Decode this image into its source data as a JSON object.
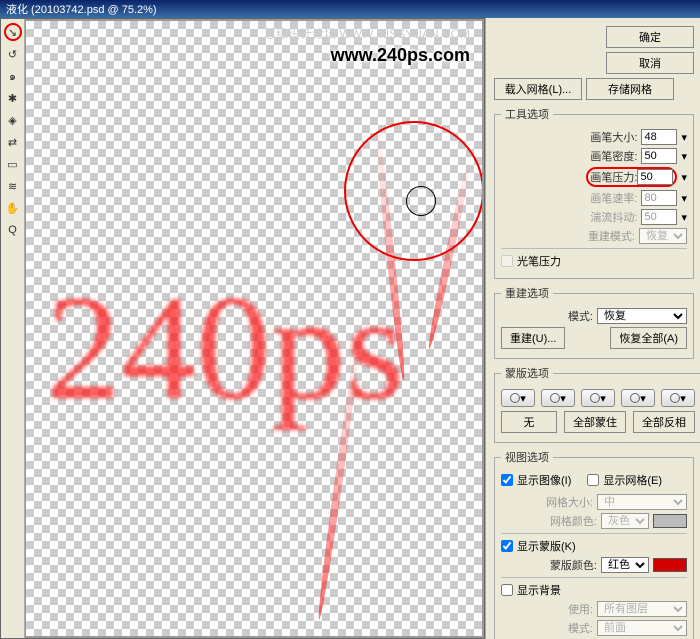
{
  "title": "液化 (20103742.psd @ 75.2%)",
  "watermark": {
    "site": "思缘设计论坛 WWW.MISSYUAN.COM",
    "logo": "www.240ps.com"
  },
  "canvasText": "240ps",
  "buttons": {
    "ok": "确定",
    "cancel": "取消",
    "loadMesh": "载入网格(L)...",
    "saveMesh": "存储网格"
  },
  "toolOptions": {
    "legend": "工具选项",
    "brushSizeLabel": "画笔大小:",
    "brushSize": "48",
    "brushDensityLabel": "画笔密度:",
    "brushDensity": "50",
    "brushPressureLabel": "画笔压力:",
    "brushPressure": "50",
    "brushRateLabel": "画笔速率:",
    "brushRate": "80",
    "turbJitterLabel": "湍流抖动:",
    "turbJitter": "50",
    "reconstructModeLabel": "重建模式:",
    "reconstructMode": "恢复",
    "stylusLabel": "光笔压力"
  },
  "reconstruct": {
    "legend": "重建选项",
    "modeLabel": "模式:",
    "mode": "恢复",
    "reconstructBtn": "重建(U)...",
    "restoreAllBtn": "恢复全部(A)"
  },
  "mask": {
    "legend": "蒙版选项",
    "none": "无",
    "maskAll": "全部蒙住",
    "invertAll": "全部反相"
  },
  "view": {
    "legend": "视图选项",
    "showImage": "显示图像(I)",
    "showMesh": "显示网格(E)",
    "meshSizeLabel": "网格大小:",
    "meshSize": "中",
    "meshColorLabel": "网格颜色:",
    "meshColor": "灰色",
    "showMask": "显示蒙版(K)",
    "maskColorLabel": "蒙版颜色:",
    "maskColor": "红色",
    "showBg": "显示背景",
    "useLabel": "使用:",
    "use": "所有图层",
    "modeLabel2": "模式:",
    "mode2": "前面"
  },
  "tools": [
    "forward-warp",
    "reconstruct",
    "twirl-cw",
    "pucker",
    "bloat",
    "push-left",
    "mirror",
    "turbulence",
    "freeze-mask",
    "thaw-mask"
  ]
}
